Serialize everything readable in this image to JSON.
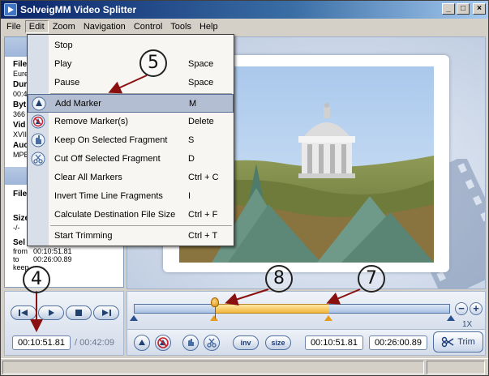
{
  "window": {
    "title": "SolveigMM Video Splitter"
  },
  "window_controls": [
    "_",
    "□",
    "×"
  ],
  "menubar": [
    "File",
    "Edit",
    "Zoom",
    "Navigation",
    "Control",
    "Tools",
    "Help"
  ],
  "info_panel": {
    "file_label": "File",
    "file_value": "Eure",
    "duration_label": "Dur",
    "duration_value": "00:4",
    "bytes_label": "Byt",
    "bytes_value": "366",
    "video_label": "Vid",
    "video_value": "XVII",
    "audio_label": "Auc",
    "audio_value": "MPE",
    "dest_file_label": "File",
    "size_label": "Size",
    "size_value": "-/-",
    "sel_label": "Sel",
    "from_label": "from",
    "from_value": "00:10:51.81",
    "to_label": "to",
    "to_value": "00:26:00.89",
    "keep_label": "keep"
  },
  "edit_menu": {
    "items": [
      {
        "label": "Stop",
        "shortcut": ""
      },
      {
        "label": "Play",
        "shortcut": "Space"
      },
      {
        "label": "Pause",
        "shortcut": "Space"
      },
      {
        "label": "Add Marker",
        "shortcut": "M",
        "highlighted": true,
        "icon": "add-marker-icon"
      },
      {
        "label": "Remove Marker(s)",
        "shortcut": "Delete",
        "icon": "remove-marker-icon"
      },
      {
        "label": "Keep On Selected Fragment",
        "shortcut": "S",
        "icon": "keep-fragment-icon"
      },
      {
        "label": "Cut Off Selected Fragment",
        "shortcut": "D",
        "icon": "cut-fragment-icon"
      },
      {
        "label": "Clear All Markers",
        "shortcut": "Ctrl + C"
      },
      {
        "label": "Invert Time Line Fragments",
        "shortcut": "I"
      },
      {
        "label": "Calculate Destination File Size",
        "shortcut": "Ctrl + F"
      },
      {
        "label": "Start Trimming",
        "shortcut": "Ctrl + T"
      }
    ]
  },
  "playback": {
    "current_time": "00:10:51.81",
    "total_time": "/ 00:42:09"
  },
  "timeline": {
    "zoom_label": "1X",
    "zoom_minus": "−",
    "zoom_plus": "+",
    "selection_start_fraction": 0.257,
    "selection_end_fraction": 0.618
  },
  "trim_controls": {
    "inv_label": "inv",
    "size_label": "size",
    "start_time": "00:10:51.81",
    "end_time": "00:26:00.89",
    "trim_label": "Trim"
  },
  "callouts": [
    "5",
    "4",
    "8",
    "7"
  ],
  "colors": {
    "accent": "#2a4f8f",
    "selection": "#f2b53b",
    "menu_highlight": "#b3bed3"
  }
}
